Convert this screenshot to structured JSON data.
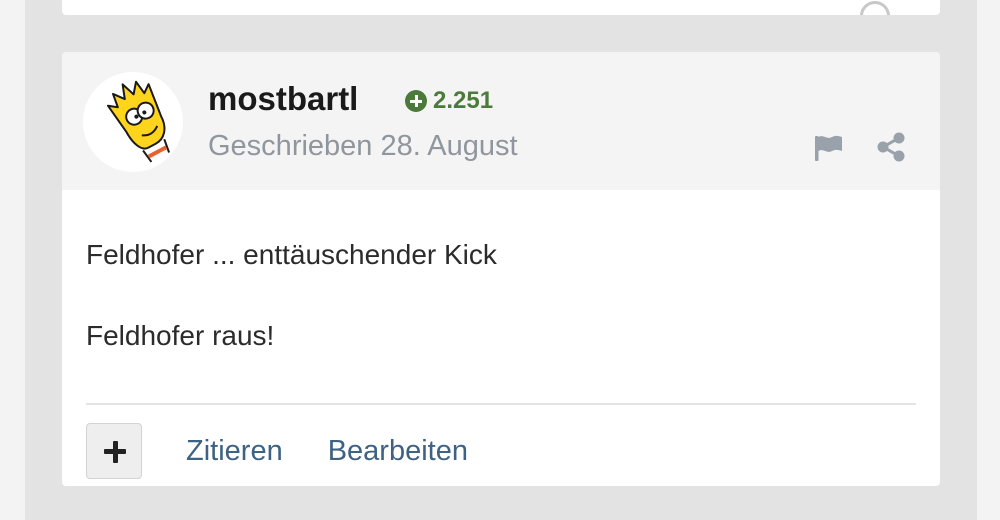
{
  "post": {
    "author": {
      "name": "mostbartl",
      "avatar_icon": "bart-simpson-avatar",
      "reputation": "2.251",
      "reputation_icon": "plus-circle-icon",
      "reputation_color": "#4b7a3b"
    },
    "date": "Geschrieben 28. August",
    "header_actions": [
      {
        "icon": "flag-icon"
      },
      {
        "icon": "share-icon"
      }
    ],
    "content": {
      "line1": "Feldhofer ... enttäuschender Kick",
      "line2": "Feldhofer raus!"
    },
    "controls": {
      "multiquote_icon": "plus-icon",
      "quote_label": "Zitieren",
      "edit_label": "Bearbeiten",
      "link_color": "#3e6283"
    }
  }
}
